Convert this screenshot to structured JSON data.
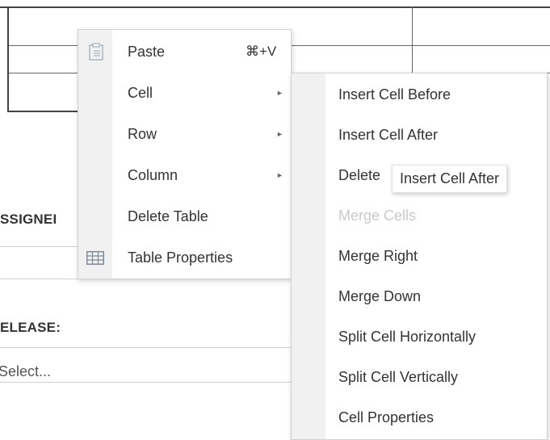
{
  "background": {
    "assigned_label": "SSIGNEI",
    "release_label": "ELEASE:",
    "select_placeholder": "Select..."
  },
  "context_menu": {
    "items": [
      {
        "label": "Paste",
        "shortcut": "⌘+V",
        "icon": "paste-icon"
      },
      {
        "label": "Cell",
        "has_submenu": true
      },
      {
        "label": "Row",
        "has_submenu": true
      },
      {
        "label": "Column",
        "has_submenu": true
      },
      {
        "label": "Delete Table"
      },
      {
        "label": "Table Properties",
        "icon": "table-icon"
      }
    ]
  },
  "cell_submenu": {
    "items": [
      {
        "label": "Insert Cell Before"
      },
      {
        "label": "Insert Cell After"
      },
      {
        "label": "Delete"
      },
      {
        "label": "Merge Cells",
        "disabled": true
      },
      {
        "label": "Merge Right"
      },
      {
        "label": "Merge Down"
      },
      {
        "label": "Split Cell Horizontally"
      },
      {
        "label": "Split Cell Vertically"
      },
      {
        "label": "Cell Properties"
      }
    ]
  },
  "tooltip": {
    "text": "Insert Cell After"
  }
}
